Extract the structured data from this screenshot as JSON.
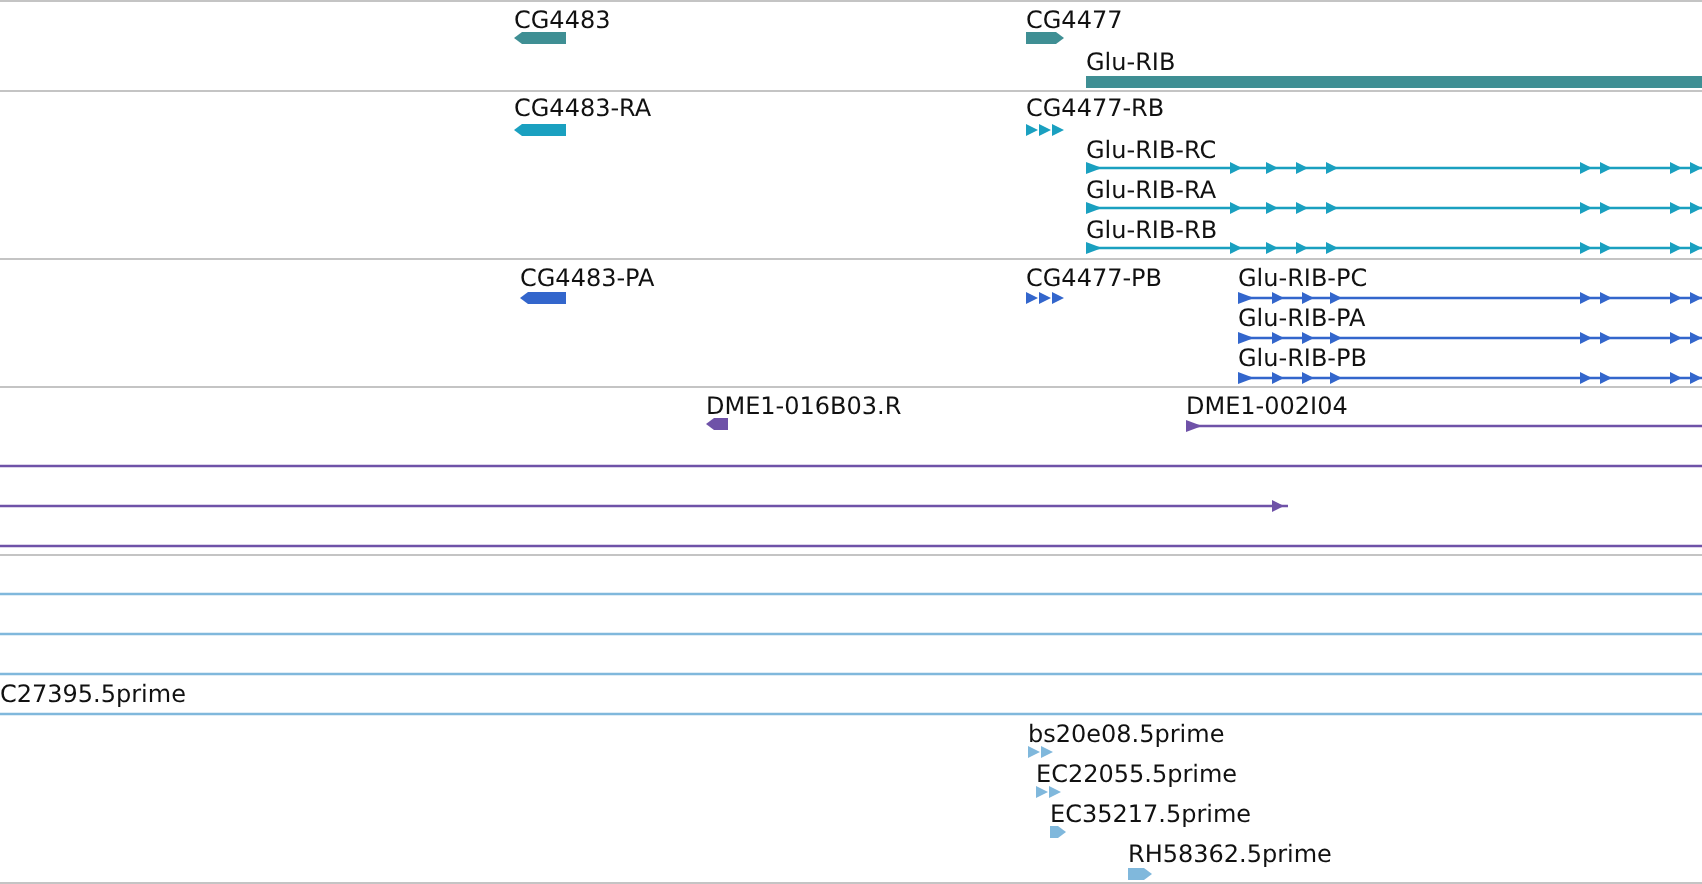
{
  "tracks": [
    {
      "color": "#3f8f94",
      "features": [
        {
          "label": "CG4483",
          "kind": "block",
          "reverse": true
        },
        {
          "label": "CG4477",
          "kind": "block",
          "reverse": false
        },
        {
          "label": "Glu-RIB",
          "kind": "bar"
        }
      ]
    },
    {
      "color": "#1aa0c0",
      "features": [
        {
          "label": "CG4483-RA",
          "kind": "block",
          "reverse": true
        },
        {
          "label": "CG4477-RB",
          "kind": "chevrons",
          "reverse": false
        },
        {
          "label": "Glu-RIB-RC",
          "kind": "exons",
          "reverse": false
        },
        {
          "label": "Glu-RIB-RA",
          "kind": "exons",
          "reverse": false
        },
        {
          "label": "Glu-RIB-RB",
          "kind": "exons",
          "reverse": false
        }
      ]
    },
    {
      "color": "#3366cc",
      "features": [
        {
          "label": "CG4483-PA",
          "kind": "block",
          "reverse": true
        },
        {
          "label": "CG4477-PB",
          "kind": "chevrons",
          "reverse": false
        },
        {
          "label": "Glu-RIB-PC",
          "kind": "exons",
          "reverse": false
        },
        {
          "label": "Glu-RIB-PA",
          "kind": "exons",
          "reverse": false
        },
        {
          "label": "Glu-RIB-PB",
          "kind": "exons",
          "reverse": false
        }
      ]
    },
    {
      "color": "#6f52a8",
      "features": [
        {
          "label": "DME1-016B03.R",
          "kind": "block",
          "reverse": true
        },
        {
          "label": "DME1-002I04",
          "kind": "exons",
          "reverse": false
        },
        {
          "kind": "line"
        },
        {
          "kind": "exons",
          "reverse": false
        },
        {
          "kind": "line"
        }
      ]
    },
    {
      "color": "#80b8dc",
      "features": [
        {
          "kind": "line"
        },
        {
          "kind": "line"
        },
        {
          "kind": "line"
        },
        {
          "label": "C27395.5prime",
          "kind": "line"
        },
        {
          "label": "bs20e08.5prime",
          "kind": "chevrons",
          "reverse": false
        },
        {
          "label": "EC22055.5prime",
          "kind": "chevrons",
          "reverse": false
        },
        {
          "label": "EC35217.5prime",
          "kind": "block",
          "reverse": false
        },
        {
          "label": "RH58362.5prime",
          "kind": "block",
          "reverse": false
        }
      ]
    }
  ]
}
